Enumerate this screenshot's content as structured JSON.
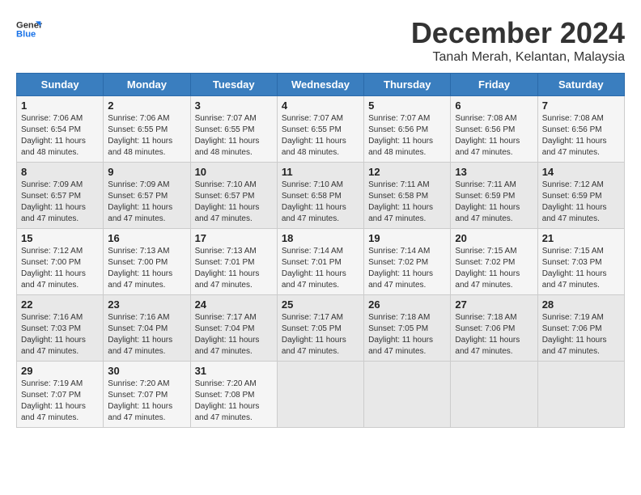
{
  "logo": {
    "text_general": "General",
    "text_blue": "Blue"
  },
  "title": "December 2024",
  "subtitle": "Tanah Merah, Kelantan, Malaysia",
  "days_of_week": [
    "Sunday",
    "Monday",
    "Tuesday",
    "Wednesday",
    "Thursday",
    "Friday",
    "Saturday"
  ],
  "weeks": [
    [
      {
        "num": "1",
        "sunrise": "7:06 AM",
        "sunset": "6:54 PM",
        "daylight": "11 hours and 48 minutes."
      },
      {
        "num": "2",
        "sunrise": "7:06 AM",
        "sunset": "6:55 PM",
        "daylight": "11 hours and 48 minutes."
      },
      {
        "num": "3",
        "sunrise": "7:07 AM",
        "sunset": "6:55 PM",
        "daylight": "11 hours and 48 minutes."
      },
      {
        "num": "4",
        "sunrise": "7:07 AM",
        "sunset": "6:55 PM",
        "daylight": "11 hours and 48 minutes."
      },
      {
        "num": "5",
        "sunrise": "7:07 AM",
        "sunset": "6:56 PM",
        "daylight": "11 hours and 48 minutes."
      },
      {
        "num": "6",
        "sunrise": "7:08 AM",
        "sunset": "6:56 PM",
        "daylight": "11 hours and 47 minutes."
      },
      {
        "num": "7",
        "sunrise": "7:08 AM",
        "sunset": "6:56 PM",
        "daylight": "11 hours and 47 minutes."
      }
    ],
    [
      {
        "num": "8",
        "sunrise": "7:09 AM",
        "sunset": "6:57 PM",
        "daylight": "11 hours and 47 minutes."
      },
      {
        "num": "9",
        "sunrise": "7:09 AM",
        "sunset": "6:57 PM",
        "daylight": "11 hours and 47 minutes."
      },
      {
        "num": "10",
        "sunrise": "7:10 AM",
        "sunset": "6:57 PM",
        "daylight": "11 hours and 47 minutes."
      },
      {
        "num": "11",
        "sunrise": "7:10 AM",
        "sunset": "6:58 PM",
        "daylight": "11 hours and 47 minutes."
      },
      {
        "num": "12",
        "sunrise": "7:11 AM",
        "sunset": "6:58 PM",
        "daylight": "11 hours and 47 minutes."
      },
      {
        "num": "13",
        "sunrise": "7:11 AM",
        "sunset": "6:59 PM",
        "daylight": "11 hours and 47 minutes."
      },
      {
        "num": "14",
        "sunrise": "7:12 AM",
        "sunset": "6:59 PM",
        "daylight": "11 hours and 47 minutes."
      }
    ],
    [
      {
        "num": "15",
        "sunrise": "7:12 AM",
        "sunset": "7:00 PM",
        "daylight": "11 hours and 47 minutes."
      },
      {
        "num": "16",
        "sunrise": "7:13 AM",
        "sunset": "7:00 PM",
        "daylight": "11 hours and 47 minutes."
      },
      {
        "num": "17",
        "sunrise": "7:13 AM",
        "sunset": "7:01 PM",
        "daylight": "11 hours and 47 minutes."
      },
      {
        "num": "18",
        "sunrise": "7:14 AM",
        "sunset": "7:01 PM",
        "daylight": "11 hours and 47 minutes."
      },
      {
        "num": "19",
        "sunrise": "7:14 AM",
        "sunset": "7:02 PM",
        "daylight": "11 hours and 47 minutes."
      },
      {
        "num": "20",
        "sunrise": "7:15 AM",
        "sunset": "7:02 PM",
        "daylight": "11 hours and 47 minutes."
      },
      {
        "num": "21",
        "sunrise": "7:15 AM",
        "sunset": "7:03 PM",
        "daylight": "11 hours and 47 minutes."
      }
    ],
    [
      {
        "num": "22",
        "sunrise": "7:16 AM",
        "sunset": "7:03 PM",
        "daylight": "11 hours and 47 minutes."
      },
      {
        "num": "23",
        "sunrise": "7:16 AM",
        "sunset": "7:04 PM",
        "daylight": "11 hours and 47 minutes."
      },
      {
        "num": "24",
        "sunrise": "7:17 AM",
        "sunset": "7:04 PM",
        "daylight": "11 hours and 47 minutes."
      },
      {
        "num": "25",
        "sunrise": "7:17 AM",
        "sunset": "7:05 PM",
        "daylight": "11 hours and 47 minutes."
      },
      {
        "num": "26",
        "sunrise": "7:18 AM",
        "sunset": "7:05 PM",
        "daylight": "11 hours and 47 minutes."
      },
      {
        "num": "27",
        "sunrise": "7:18 AM",
        "sunset": "7:06 PM",
        "daylight": "11 hours and 47 minutes."
      },
      {
        "num": "28",
        "sunrise": "7:19 AM",
        "sunset": "7:06 PM",
        "daylight": "11 hours and 47 minutes."
      }
    ],
    [
      {
        "num": "29",
        "sunrise": "7:19 AM",
        "sunset": "7:07 PM",
        "daylight": "11 hours and 47 minutes."
      },
      {
        "num": "30",
        "sunrise": "7:20 AM",
        "sunset": "7:07 PM",
        "daylight": "11 hours and 47 minutes."
      },
      {
        "num": "31",
        "sunrise": "7:20 AM",
        "sunset": "7:08 PM",
        "daylight": "11 hours and 47 minutes."
      },
      null,
      null,
      null,
      null
    ]
  ]
}
